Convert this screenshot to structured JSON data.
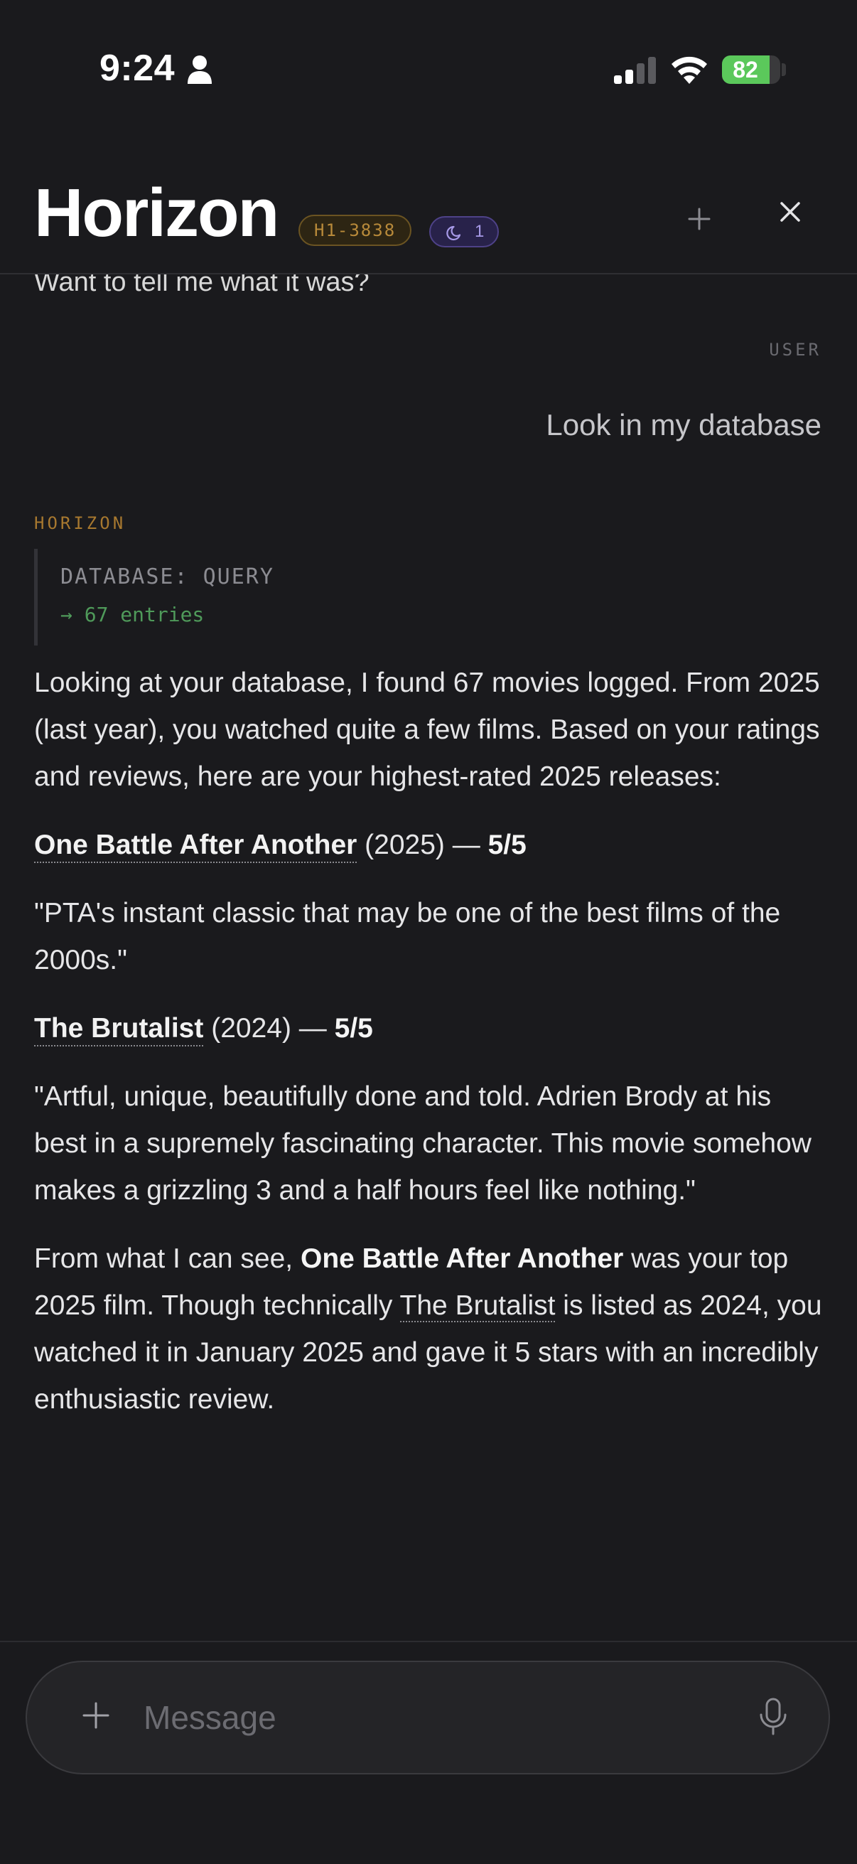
{
  "status": {
    "time": "9:24",
    "battery": "82",
    "battery_level": 0.82
  },
  "header": {
    "title": "Horizon",
    "session_id": "H1-3838",
    "moon_count": "1"
  },
  "conversation": {
    "previous_line": "Want to tell me what it was?",
    "user_role_label": "USER",
    "user_message": "Look in my database",
    "assistant_role_label": "HORIZON",
    "tool_call": {
      "name": "DATABASE: QUERY",
      "result": "→ 67 entries"
    },
    "answer": {
      "intro": "Looking at your database, I found 67 movies logged. From 2025 (last year), you watched quite a few films. Based on your ratings and reviews, here are your highest-rated 2025 releases:",
      "movies": [
        {
          "title": "One Battle After Another",
          "year": "(2025)",
          "dash": " — ",
          "rating": "5/5",
          "review": "\"PTA's instant classic that may be one of the best films of the 2000s.\""
        },
        {
          "title": "The Brutalist",
          "year": "(2024)",
          "dash": " — ",
          "rating": "5/5",
          "review": "\"Artful, unique, beautifully done and told. Adrien Brody at his best in a supremely fascinating character. This movie somehow makes a grizzling 3 and a half hours feel like nothing.\""
        }
      ],
      "conclusion": {
        "part1": "From what I can see, ",
        "bold_title": "One Battle After Another",
        "part2": " was your top 2025 film. Though technically ",
        "link_title": "The Brutalist",
        "part3": " is listed as 2024, you watched it in January 2025 and gave it 5 stars with an incredibly enthusiastic review."
      }
    }
  },
  "composer": {
    "placeholder": "Message"
  },
  "colors": {
    "background": "#1a1a1d",
    "assistant_accent": "#a7782f",
    "tool_result": "#4f9a5a",
    "battery": "#5bc85b"
  },
  "icons": [
    "person-icon",
    "signal-icon",
    "wifi-icon",
    "moon-icon",
    "plus-icon",
    "close-icon",
    "mic-icon"
  ]
}
